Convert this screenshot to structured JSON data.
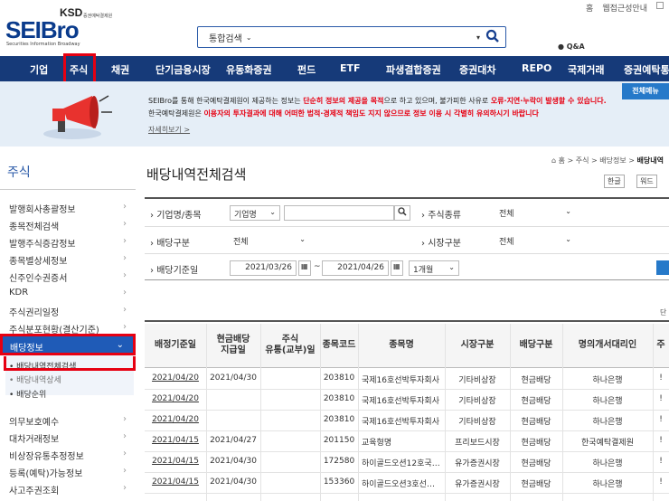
{
  "util": {
    "home": "홈",
    "site_info": "웹접근성안내"
  },
  "logo": {
    "ksd": "KSD",
    "ksd_sub": "증권예탁결제원",
    "brand": "SEIBro",
    "brand_sub": "Securities Information Broadway"
  },
  "search": {
    "scope": "통합검색",
    "dropdown": "▾"
  },
  "qa": "Q&A",
  "nav": [
    "기업",
    "주식",
    "채권",
    "단기금융시장",
    "유동화증권",
    "펀드",
    "ETF",
    "파생결합증권",
    "증권대차",
    "REPO",
    "국제거래",
    "증권예탁통"
  ],
  "notice": {
    "line1_a": "SEIBro를 통해 한국예탁결제원이 제공하는 정보는 ",
    "line1_red1": "단순히 정보의 제공을 목적",
    "line1_b": "으로 하고 있으며, 불가피한 사유로 ",
    "line1_red2": "오류·지연·누락이 발생할 수 있습니다.",
    "line2_a": "한국예탁결제원은 ",
    "line2_red": "이용자의 투자결과에 대해 어떠한 법적·경제적 책임도 지지 않으므로 정보 이용 시 각별히 유의하시기 바랍니다",
    "more": "자세히보기 >",
    "all_menu": "전체메뉴"
  },
  "sidebar": {
    "title": "주식",
    "items": [
      "발행회사총괄정보",
      "종목전체검색",
      "발행주식증감정보",
      "종목별상세정보",
      "신주인수권증서",
      "KDR",
      "주식권리일정",
      "주식분포현황(결산기준)"
    ],
    "active": "배당정보",
    "sub": [
      "배당내역전체검색",
      "배당내역상세",
      "배당순위"
    ],
    "items_after": [
      "의무보호예수",
      "대차거래정보",
      "비상장유통추정정보",
      "등록(예탁)가능정보",
      "사고주권조회"
    ]
  },
  "page": {
    "title": "배당내역전체검색",
    "crumb_home": "홈",
    "crumb_1": "주식",
    "crumb_2": "배당정보",
    "crumb_3": "배당내역",
    "dl_hangul": "한글",
    "dl_word": "워드"
  },
  "form": {
    "company_label": "기업명/종목",
    "company_sel": "기업명",
    "stock_type_label": "주식종류",
    "stock_type_val": "전체",
    "div_type_label": "배당구분",
    "div_type_val": "전체",
    "market_label": "시장구분",
    "market_val": "전체",
    "date_label": "배당기준일",
    "date_from": "2021/03/26",
    "date_sep": "~",
    "date_to": "2021/04/26",
    "period": "1개월"
  },
  "unit": "단",
  "table": {
    "headers": [
      "배정기준일",
      "현금배당\n지급일",
      "주식\n유통(교부)일",
      "종목코드",
      "종목명",
      "시장구분",
      "배당구분",
      "명의개서대리인",
      "주"
    ],
    "rows": [
      [
        "2021/04/20",
        "2021/04/30",
        "",
        "203810",
        "국제16호선박투자회사",
        "기타비상장",
        "현금배당",
        "하나은행",
        "!"
      ],
      [
        "2021/04/20",
        "",
        "",
        "203810",
        "국제16호선박투자회사",
        "기타비상장",
        "현금배당",
        "하나은행",
        "!"
      ],
      [
        "2021/04/20",
        "",
        "",
        "203810",
        "국제16호선박투자회사",
        "기타비상장",
        "현금배당",
        "하나은행",
        "!"
      ],
      [
        "2021/04/15",
        "2021/04/27",
        "",
        "201150",
        "교육형명",
        "프리보드시장",
        "현금배당",
        "한국예탁결제원",
        "!"
      ],
      [
        "2021/04/15",
        "2021/04/30",
        "",
        "172580",
        "하이골드오션12호국…",
        "유가증권시장",
        "현금배당",
        "하나은행",
        "!"
      ],
      [
        "2021/04/15",
        "2021/04/30",
        "",
        "153360",
        "하이골드오션3호선…",
        "유가증권시장",
        "현금배당",
        "하나은행",
        "!"
      ]
    ]
  }
}
